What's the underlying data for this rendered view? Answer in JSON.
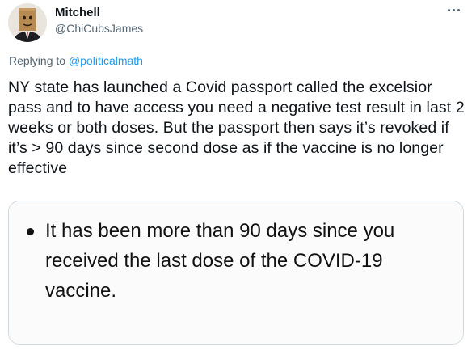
{
  "author": {
    "name": "Mitchell",
    "handle": "@ChiCubsJames",
    "avatar_icon": "paper-bag-avatar-icon"
  },
  "more_icon": "more-horizontal-icon",
  "reply": {
    "prefix": "Replying to ",
    "mention": "@politicalmath"
  },
  "tweet": {
    "text": "NY state has launched a Covid passport called the excelsior pass and to have access you need a negative test result in last 2 weeks or both doses. But the passport then says it’s revoked if it’s > 90 days since second dose as if the vaccine is no longer effective"
  },
  "media": {
    "bullet_text": "It has been more than 90 days since you received the last dose of the COVID-19 vaccine."
  },
  "colors": {
    "link": "#1d9bf0",
    "secondary_text": "#536471",
    "primary_text": "#0f1419",
    "card_border": "#cfd9de"
  }
}
